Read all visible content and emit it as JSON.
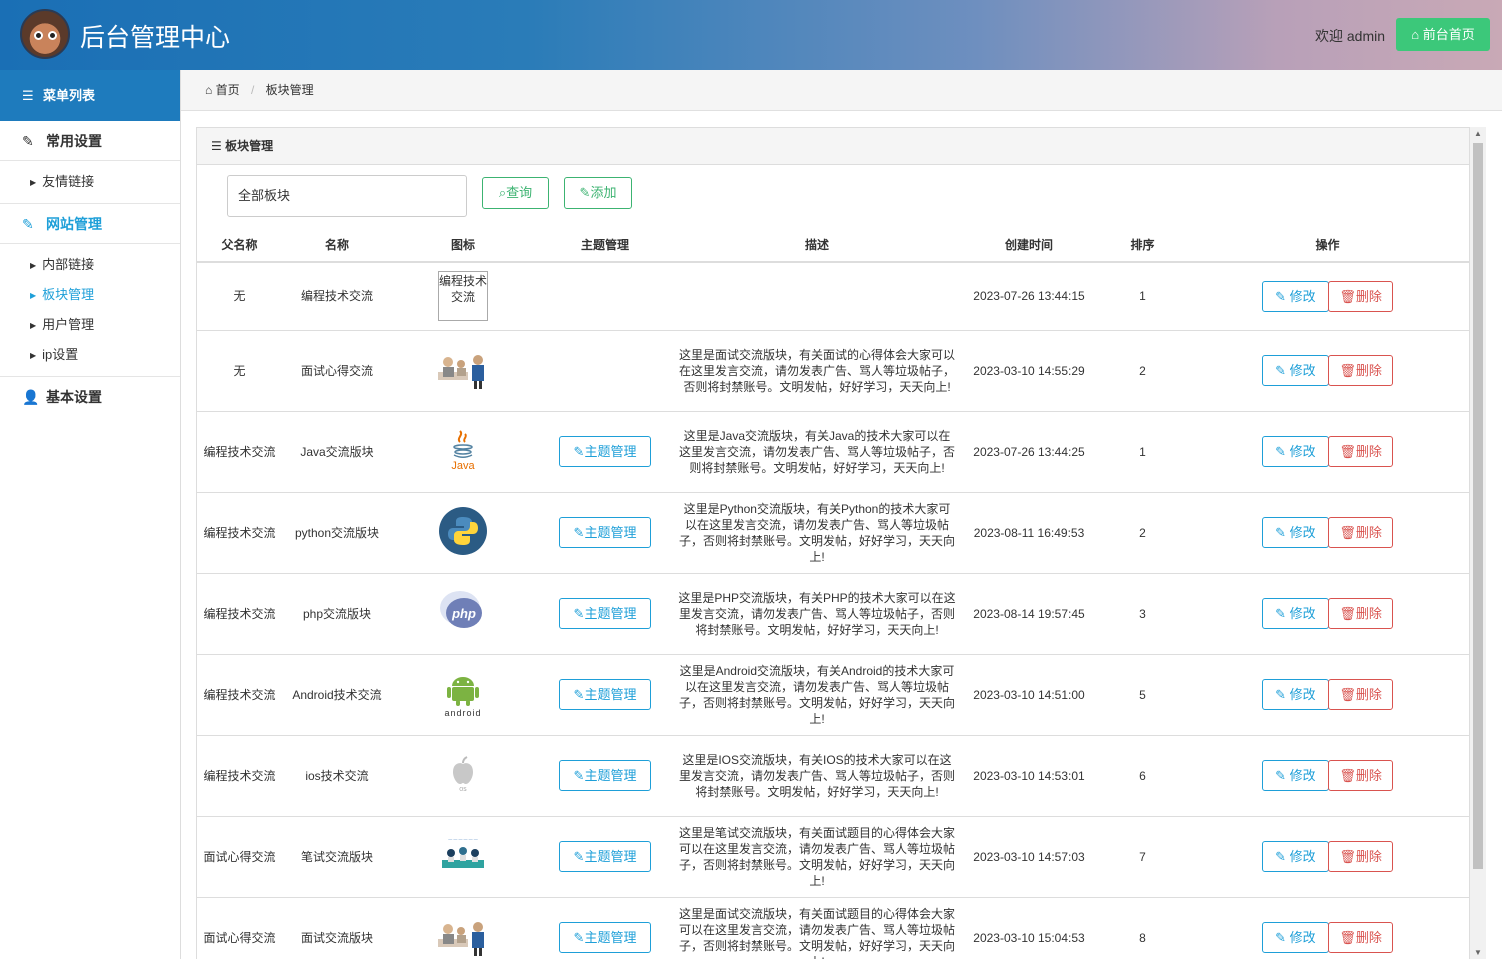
{
  "header": {
    "title": "后台管理中心",
    "welcome": "欢迎 admin",
    "home_button": "前台首页",
    "home_icon": "home-icon"
  },
  "sidebar": {
    "menu_title": "菜单列表",
    "groups": [
      {
        "label": "常用设置",
        "icon": "edit-icon",
        "items": [
          {
            "label": "友情链接"
          }
        ]
      },
      {
        "label": "网站管理",
        "icon": "edit-icon",
        "items": [
          {
            "label": "内部链接"
          },
          {
            "label": "板块管理"
          },
          {
            "label": "用户管理"
          },
          {
            "label": "ip设置"
          }
        ]
      },
      {
        "label": "基本设置",
        "icon": "user-icon",
        "items": []
      }
    ]
  },
  "breadcrumb": {
    "home": "首页",
    "current": "板块管理"
  },
  "panel": {
    "title": "板块管理",
    "filter_value": "全部板块",
    "query_button": "查询",
    "add_button": "添加"
  },
  "table": {
    "columns": [
      "父名称",
      "名称",
      "图标",
      "主题管理",
      "描述",
      "创建时间",
      "排序",
      "操作"
    ],
    "topic_button": "主题管理",
    "edit_button": "修改",
    "delete_button": "删除",
    "rows": [
      {
        "parent": "无",
        "name": "编程技术交流",
        "icon": "broken-image",
        "icon_alt": "编程技术交流",
        "has_topic": false,
        "desc": "",
        "time": "2023-07-26 13:44:15",
        "order": "1"
      },
      {
        "parent": "无",
        "name": "面试心得交流",
        "icon": "interview-image",
        "has_topic": false,
        "desc": "这里是面试交流版块，有关面试的心得体会大家可以在这里发言交流，请勿发表广告、骂人等垃圾帖子，否则将封禁账号。文明发帖，好好学习，天天向上!",
        "time": "2023-03-10 14:55:29",
        "order": "2"
      },
      {
        "parent": "编程技术交流",
        "name": "Java交流版块",
        "icon": "java-logo",
        "has_topic": true,
        "desc": "这里是Java交流版块，有关Java的技术大家可以在这里发言交流，请勿发表广告、骂人等垃圾帖子，否则将封禁账号。文明发帖，好好学习，天天向上!",
        "time": "2023-07-26 13:44:25",
        "order": "1"
      },
      {
        "parent": "编程技术交流",
        "name": "python交流版块",
        "icon": "python-logo",
        "has_topic": true,
        "desc": "这里是Python交流版块，有关Python的技术大家可以在这里发言交流，请勿发表广告、骂人等垃圾帖子，否则将封禁账号。文明发帖，好好学习，天天向上!",
        "time": "2023-08-11 16:49:53",
        "order": "2"
      },
      {
        "parent": "编程技术交流",
        "name": "php交流版块",
        "icon": "php-logo",
        "has_topic": true,
        "desc": "这里是PHP交流版块，有关PHP的技术大家可以在这里发言交流，请勿发表广告、骂人等垃圾帖子，否则将封禁账号。文明发帖，好好学习，天天向上!",
        "time": "2023-08-14 19:57:45",
        "order": "3"
      },
      {
        "parent": "编程技术交流",
        "name": "Android技术交流",
        "icon": "android-logo",
        "has_topic": true,
        "desc": "这里是Android交流版块，有关Android的技术大家可以在这里发言交流，请勿发表广告、骂人等垃圾帖子，否则将封禁账号。文明发帖，好好学习，天天向上!",
        "time": "2023-03-10 14:51:00",
        "order": "5"
      },
      {
        "parent": "编程技术交流",
        "name": "ios技术交流",
        "icon": "apple-logo",
        "has_topic": true,
        "desc": "这里是IOS交流版块，有关IOS的技术大家可以在这里发言交流，请勿发表广告、骂人等垃圾帖子，否则将封禁账号。文明发帖，好好学习，天天向上!",
        "time": "2023-03-10 14:53:01",
        "order": "6"
      },
      {
        "parent": "面试心得交流",
        "name": "笔试交流版块",
        "icon": "exam-image",
        "has_topic": true,
        "desc": "这里是笔试交流版块，有关面试题目的心得体会大家可以在这里发言交流，请勿发表广告、骂人等垃圾帖子，否则将封禁账号。文明发帖，好好学习，天天向上!",
        "time": "2023-03-10 14:57:03",
        "order": "7"
      },
      {
        "parent": "面试心得交流",
        "name": "面试交流版块",
        "icon": "interview-image",
        "has_topic": true,
        "desc": "这里是面试交流版块，有关面试题目的心得体会大家可以在这里发言交流，请勿发表广告、骂人等垃圾帖子，否则将封禁账号。文明发帖，好好学习，天天向上!",
        "time": "2023-03-10 15:04:53",
        "order": "8"
      }
    ]
  },
  "colors": {
    "brand_blue": "#1e7bbd",
    "accent": "#1e9fd8",
    "green": "#3cc87a",
    "danger": "#d9534f"
  }
}
